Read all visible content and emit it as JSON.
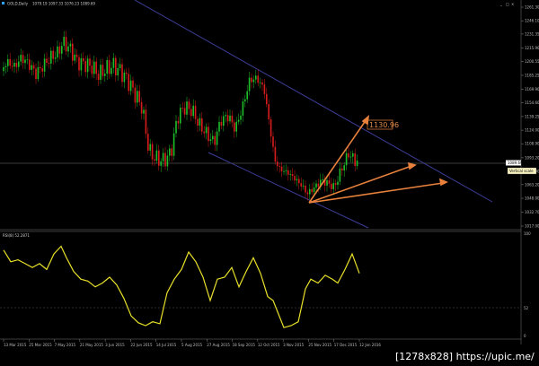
{
  "window": {
    "title": "GOLD,Daily",
    "ohlc": "1079.19 1097.33 1076.23 1089.69",
    "buttons": {
      "minimize": "_",
      "restore": "□",
      "close": "×"
    }
  },
  "price_panel": {
    "y_ticks": [
      "1261.30",
      "1246.10",
      "1231.35",
      "1215.90",
      "1200.55",
      "1185.25",
      "1169.90",
      "1154.60",
      "1139.25",
      "1124.00",
      "1108.90",
      "1093.20",
      "1077.90",
      "1063.20",
      "1048.00",
      "1032.70",
      "1017.00"
    ],
    "current_price": "1089.69",
    "vertical_scale_label": "Vertical scale",
    "annotation_label": "1130.96"
  },
  "rsi_panel": {
    "title": "RSI(8) 52.2871",
    "levels": [
      "100",
      "52",
      "0"
    ]
  },
  "x_axis": {
    "labels": [
      "13 Mar 2015",
      "25 Mar 2015",
      "7 May 2015",
      "21 May 2015",
      "3 Jun 2015",
      "22 Jun 2015",
      "14 Jul 2015",
      "5 Aug 2015",
      "27 Aug 2015",
      "18 Sep 2015",
      "12 Oct 2015",
      "3 Nov 2015",
      "25 Nov 2015",
      "17 Dec 2015",
      "12 Jan 2016"
    ]
  },
  "watermark": "[1278x828] https://upic.me/",
  "colors": {
    "bull": "#1fbf2a",
    "bear": "#d81c1c",
    "rsi": "#e8e02a",
    "channel": "#3e3e9a",
    "arrow": "#e8813c"
  },
  "chart_data": {
    "type": "candlestick",
    "title": "GOLD,Daily",
    "ylim": [
      1017,
      1261.3
    ],
    "rsi_period": 8,
    "rsi_levels": [
      100,
      52,
      0
    ],
    "approx_close_path": [
      [
        0,
        1190
      ],
      [
        8,
        1200
      ],
      [
        16,
        1195
      ],
      [
        24,
        1205
      ],
      [
        32,
        1198
      ],
      [
        40,
        1187
      ],
      [
        48,
        1196
      ],
      [
        56,
        1205
      ],
      [
        64,
        1210
      ],
      [
        70,
        1222
      ],
      [
        78,
        1215
      ],
      [
        86,
        1200
      ],
      [
        94,
        1198
      ],
      [
        102,
        1195
      ],
      [
        110,
        1186
      ],
      [
        118,
        1192
      ],
      [
        126,
        1196
      ],
      [
        134,
        1190
      ],
      [
        142,
        1180
      ],
      [
        150,
        1165
      ],
      [
        158,
        1150
      ],
      [
        166,
        1100
      ],
      [
        174,
        1092
      ],
      [
        182,
        1090
      ],
      [
        190,
        1098
      ],
      [
        198,
        1140
      ],
      [
        206,
        1150
      ],
      [
        214,
        1146
      ],
      [
        222,
        1130
      ],
      [
        230,
        1120
      ],
      [
        238,
        1110
      ],
      [
        246,
        1135
      ],
      [
        254,
        1140
      ],
      [
        262,
        1125
      ],
      [
        270,
        1150
      ],
      [
        278,
        1180
      ],
      [
        286,
        1182
      ],
      [
        294,
        1170
      ],
      [
        300,
        1130
      ],
      [
        306,
        1090
      ],
      [
        312,
        1080
      ],
      [
        320,
        1077
      ],
      [
        328,
        1070
      ],
      [
        336,
        1062
      ],
      [
        342,
        1053
      ],
      [
        350,
        1060
      ],
      [
        358,
        1068
      ],
      [
        366,
        1064
      ],
      [
        372,
        1060
      ],
      [
        380,
        1080
      ],
      [
        388,
        1098
      ],
      [
        396,
        1089
      ]
    ],
    "approx_rsi_path": [
      [
        0,
        10
      ],
      [
        8,
        22
      ],
      [
        16,
        20
      ],
      [
        24,
        24
      ],
      [
        32,
        28
      ],
      [
        40,
        24
      ],
      [
        48,
        30
      ],
      [
        56,
        14
      ],
      [
        64,
        6
      ],
      [
        70,
        18
      ],
      [
        78,
        32
      ],
      [
        86,
        40
      ],
      [
        94,
        42
      ],
      [
        102,
        48
      ],
      [
        110,
        44
      ],
      [
        118,
        38
      ],
      [
        126,
        46
      ],
      [
        134,
        60
      ],
      [
        142,
        78
      ],
      [
        150,
        85
      ],
      [
        158,
        88
      ],
      [
        166,
        84
      ],
      [
        174,
        86
      ],
      [
        182,
        54
      ],
      [
        190,
        40
      ],
      [
        198,
        30
      ],
      [
        206,
        12
      ],
      [
        214,
        22
      ],
      [
        222,
        38
      ],
      [
        230,
        62
      ],
      [
        238,
        40
      ],
      [
        246,
        38
      ],
      [
        254,
        28
      ],
      [
        262,
        48
      ],
      [
        270,
        32
      ],
      [
        278,
        18
      ],
      [
        286,
        34
      ],
      [
        294,
        58
      ],
      [
        300,
        62
      ],
      [
        306,
        76
      ],
      [
        312,
        90
      ],
      [
        320,
        88
      ],
      [
        328,
        84
      ],
      [
        336,
        50
      ],
      [
        342,
        40
      ],
      [
        350,
        44
      ],
      [
        358,
        36
      ],
      [
        366,
        40
      ],
      [
        372,
        44
      ],
      [
        380,
        30
      ],
      [
        388,
        14
      ],
      [
        396,
        34
      ]
    ]
  }
}
